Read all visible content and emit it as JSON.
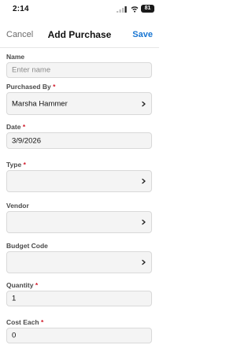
{
  "status": {
    "time": "2:14",
    "battery": "81"
  },
  "nav": {
    "cancel_label": "Cancel",
    "title": "Add Purchase",
    "save_label": "Save"
  },
  "fields": {
    "name": {
      "label": "Name",
      "placeholder": "Enter name"
    },
    "purchased_by": {
      "label": "Purchased By",
      "required": "*",
      "value": "Marsha Hammer"
    },
    "date": {
      "label": "Date",
      "required": "*",
      "value": "3/9/2026"
    },
    "type": {
      "label": "Type",
      "required": "*",
      "value": ""
    },
    "vendor": {
      "label": "Vendor",
      "value": ""
    },
    "budget_code": {
      "label": "Budget Code",
      "value": ""
    },
    "quantity": {
      "label": "Quantity",
      "required": "*",
      "value": "1"
    },
    "cost_each": {
      "label": "Cost Each",
      "required": "*",
      "value": "0"
    }
  },
  "colors": {
    "accent": "#1976d2",
    "required": "#d11a2a"
  }
}
